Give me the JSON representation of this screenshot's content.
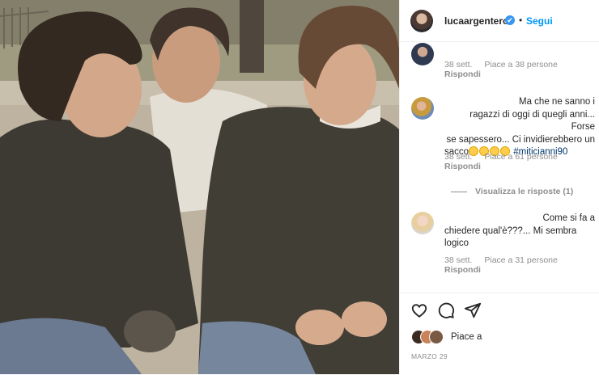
{
  "header": {
    "username": "lucaargentero",
    "verified_mark": "✔",
    "separator": "•",
    "follow_label": "Segui"
  },
  "comments": [
    {
      "id": "c1",
      "text": "",
      "time": "38 sett.",
      "likes": "Piace a 38 persone",
      "reply": "Rispondi"
    },
    {
      "id": "c2",
      "lines": [
        "Ma che ne sanno i",
        "ragazzi di oggi di quegli anni... Forse",
        "se sapessero... Ci invidierebbero un"
      ],
      "last_word": "sacco",
      "hashtag": "#miticianni90",
      "time": "38 sett.",
      "likes": "Piace a 61 persone",
      "reply": "Rispondi"
    },
    {
      "id": "c3",
      "lines": [
        "Come si fa a",
        "chiedere qual'è???... Mi sembra",
        "logico"
      ],
      "time": "38 sett.",
      "likes": "Piace a 31 persone",
      "reply": "Rispondi"
    }
  ],
  "view_replies": "Visualizza le risposte (1)",
  "actions": {
    "like_icon": "heart-icon",
    "comment_icon": "comment-icon",
    "share_icon": "share-icon",
    "likes_text": "Piace a",
    "date": "MARZO 29"
  },
  "colors": {
    "accent": "#0095f6",
    "verified": "#3897f0",
    "muted": "#8e8e8e",
    "text": "#262626"
  }
}
